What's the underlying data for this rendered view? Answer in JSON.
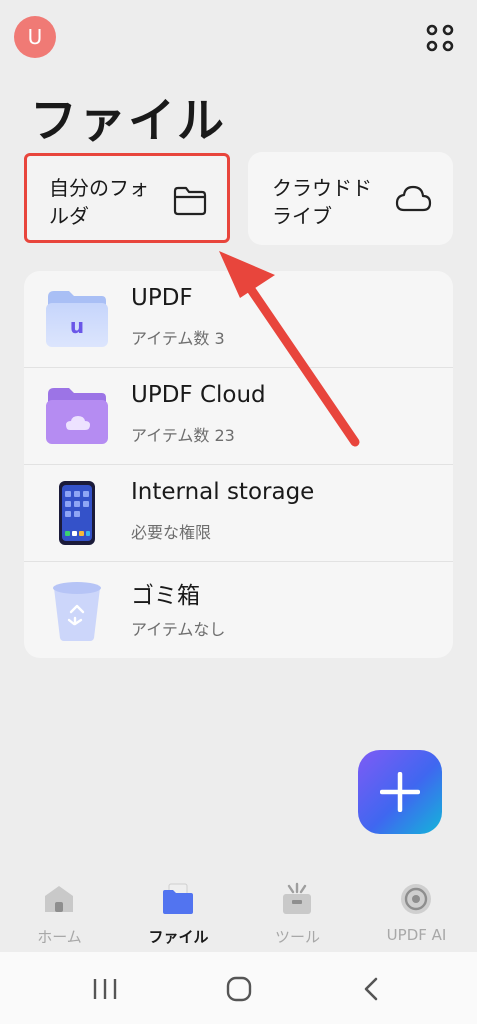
{
  "header": {
    "avatar_initial": "U"
  },
  "page_title": "ファイル",
  "quick_access": [
    {
      "label": "自分のフォ\nルダ",
      "icon": "folder-icon"
    },
    {
      "label": "クラウドド\nライブ",
      "icon": "cloud-icon"
    }
  ],
  "files": [
    {
      "title": "UPDF",
      "subtitle": "アイテム数 3",
      "icon": "updf-folder-icon"
    },
    {
      "title": "UPDF Cloud",
      "subtitle": "アイテム数 23",
      "icon": "cloud-folder-icon"
    },
    {
      "title": "Internal storage",
      "subtitle": "必要な権限",
      "icon": "phone-icon"
    },
    {
      "title": "ゴミ箱",
      "subtitle": "アイテムなし",
      "icon": "trash-icon"
    }
  ],
  "tabs": [
    {
      "label": "ホーム",
      "icon": "home-icon",
      "active": false
    },
    {
      "label": "ファイル",
      "icon": "files-icon",
      "active": true
    },
    {
      "label": "ツール",
      "icon": "tools-icon",
      "active": false
    },
    {
      "label": "UPDF AI",
      "icon": "ai-icon",
      "active": false
    }
  ],
  "colors": {
    "highlight_box": "#E8453C",
    "arrow": "#E8453C",
    "fab_gradient": [
      "#7E5BF5",
      "#3F67F0",
      "#13B6D9"
    ],
    "avatar": "#F07A75"
  }
}
